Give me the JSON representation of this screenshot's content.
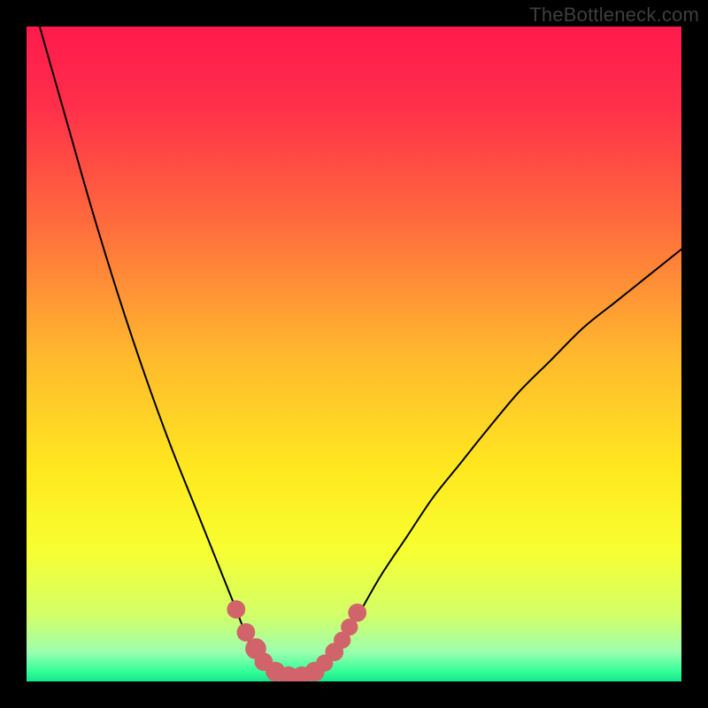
{
  "watermark": "TheBottleneck.com",
  "chart_data": {
    "type": "line",
    "title": "",
    "xlabel": "",
    "ylabel": "",
    "xlim": [
      0,
      100
    ],
    "ylim": [
      0,
      100
    ],
    "gradient_stops": [
      {
        "offset": 0.0,
        "color": "#ff1a4d"
      },
      {
        "offset": 0.12,
        "color": "#ff2f4a"
      },
      {
        "offset": 0.3,
        "color": "#ff6b3d"
      },
      {
        "offset": 0.5,
        "color": "#ffb82e"
      },
      {
        "offset": 0.68,
        "color": "#ffe91f"
      },
      {
        "offset": 0.8,
        "color": "#f7ff30"
      },
      {
        "offset": 0.9,
        "color": "#d2ff6a"
      },
      {
        "offset": 0.955,
        "color": "#9dffaf"
      },
      {
        "offset": 0.985,
        "color": "#33ff99"
      },
      {
        "offset": 1.0,
        "color": "#15e58c"
      }
    ],
    "curve": [
      {
        "x": 2,
        "y": 100
      },
      {
        "x": 6,
        "y": 86
      },
      {
        "x": 10,
        "y": 72
      },
      {
        "x": 14,
        "y": 59
      },
      {
        "x": 18,
        "y": 47
      },
      {
        "x": 22,
        "y": 36
      },
      {
        "x": 26,
        "y": 26
      },
      {
        "x": 30,
        "y": 16
      },
      {
        "x": 32,
        "y": 11
      },
      {
        "x": 34,
        "y": 6
      },
      {
        "x": 36,
        "y": 3
      },
      {
        "x": 38,
        "y": 1
      },
      {
        "x": 40,
        "y": 0.5
      },
      {
        "x": 42,
        "y": 0.5
      },
      {
        "x": 44,
        "y": 1
      },
      {
        "x": 46,
        "y": 3
      },
      {
        "x": 48,
        "y": 6
      },
      {
        "x": 50,
        "y": 9
      },
      {
        "x": 54,
        "y": 16
      },
      {
        "x": 58,
        "y": 22
      },
      {
        "x": 62,
        "y": 28
      },
      {
        "x": 66,
        "y": 33
      },
      {
        "x": 70,
        "y": 38
      },
      {
        "x": 75,
        "y": 44
      },
      {
        "x": 80,
        "y": 49
      },
      {
        "x": 85,
        "y": 54
      },
      {
        "x": 90,
        "y": 58
      },
      {
        "x": 95,
        "y": 62
      },
      {
        "x": 100,
        "y": 66
      }
    ],
    "markers": [
      {
        "x": 32.0,
        "y": 11.0,
        "r": 1.4
      },
      {
        "x": 33.5,
        "y": 7.5,
        "r": 1.4
      },
      {
        "x": 35.0,
        "y": 5.0,
        "r": 1.6
      },
      {
        "x": 36.2,
        "y": 3.0,
        "r": 1.4
      },
      {
        "x": 38.0,
        "y": 1.5,
        "r": 1.5
      },
      {
        "x": 40.0,
        "y": 0.8,
        "r": 1.5
      },
      {
        "x": 42.0,
        "y": 0.8,
        "r": 1.5
      },
      {
        "x": 44.0,
        "y": 1.5,
        "r": 1.5
      },
      {
        "x": 45.5,
        "y": 2.8,
        "r": 1.3
      },
      {
        "x": 47.0,
        "y": 4.5,
        "r": 1.4
      },
      {
        "x": 48.2,
        "y": 6.3,
        "r": 1.3
      },
      {
        "x": 49.3,
        "y": 8.3,
        "r": 1.3
      },
      {
        "x": 50.5,
        "y": 10.5,
        "r": 1.4
      }
    ],
    "colors": {
      "curve_stroke": "#000000",
      "marker_fill": "#d1636b"
    }
  }
}
